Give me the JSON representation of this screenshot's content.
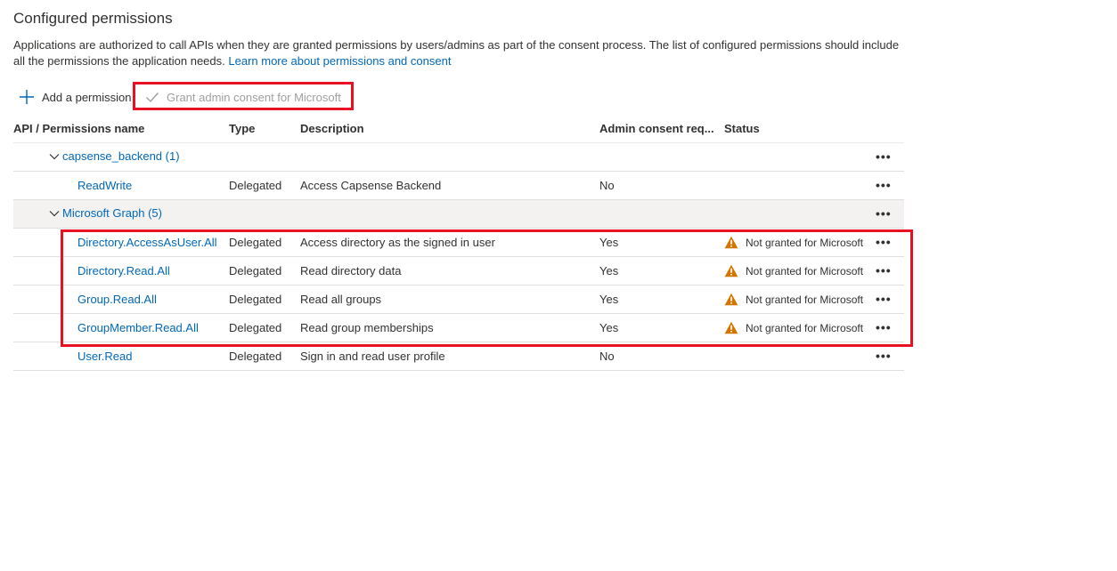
{
  "header": {
    "title": "Configured permissions",
    "description": "Applications are authorized to call APIs when they are granted permissions by users/admins as part of the consent process. The list of configured permissions should include all the permissions the application needs.",
    "learn_more": "Learn more about permissions and consent"
  },
  "toolbar": {
    "add_label": "Add a permission",
    "grant_label": "Grant admin consent for Microsoft"
  },
  "table": {
    "columns": [
      "API / Permissions name",
      "Type",
      "Description",
      "Admin consent req...",
      "Status"
    ],
    "groups": [
      {
        "label": "capsense_backend (1)",
        "rows": [
          {
            "name": "ReadWrite",
            "type": "Delegated",
            "description": "Access Capsense Backend",
            "admin": "No",
            "status": ""
          }
        ]
      },
      {
        "label": "Microsoft Graph (5)",
        "rows": [
          {
            "name": "Directory.AccessAsUser.All",
            "type": "Delegated",
            "description": "Access directory as the signed in user",
            "admin": "Yes",
            "status": "Not granted for Microsoft"
          },
          {
            "name": "Directory.Read.All",
            "type": "Delegated",
            "description": "Read directory data",
            "admin": "Yes",
            "status": "Not granted for Microsoft"
          },
          {
            "name": "Group.Read.All",
            "type": "Delegated",
            "description": "Read all groups",
            "admin": "Yes",
            "status": "Not granted for Microsoft"
          },
          {
            "name": "GroupMember.Read.All",
            "type": "Delegated",
            "description": "Read group memberships",
            "admin": "Yes",
            "status": "Not granted for Microsoft"
          },
          {
            "name": "User.Read",
            "type": "Delegated",
            "description": "Sign in and read user profile",
            "admin": "No",
            "status": ""
          }
        ]
      }
    ],
    "more_glyph": "•••"
  },
  "colors": {
    "link": "#0067b8",
    "warning": "#d47500",
    "callout": "#e81123",
    "disabled_text": "#a19f9d"
  },
  "icons": {
    "add": "plus-icon",
    "grant": "checkmark-icon",
    "expand": "chevron-down-icon",
    "warning": "warning-icon",
    "more": "more-icon"
  }
}
